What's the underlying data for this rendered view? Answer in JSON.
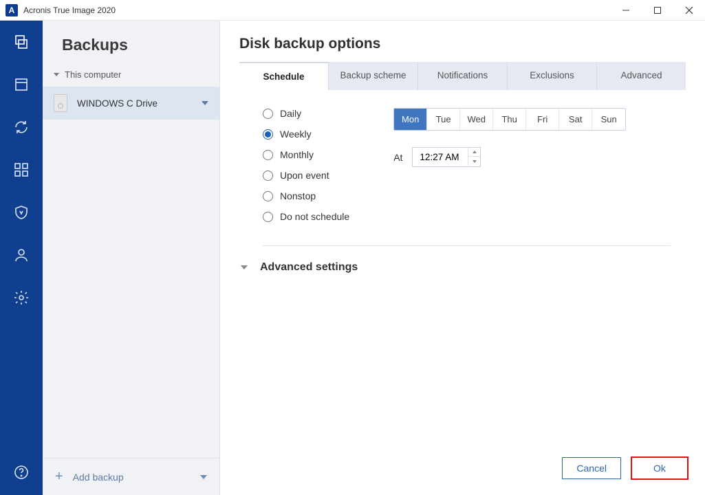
{
  "window": {
    "title": "Acronis True Image 2020",
    "logo_letter": "A"
  },
  "sidebar": {
    "heading": "Backups",
    "tree_label": "This computer",
    "plan_name": "WINDOWS C Drive",
    "add_backup_label": "Add backup"
  },
  "main": {
    "title": "Disk backup options",
    "tabs": [
      {
        "label": "Schedule",
        "active": true
      },
      {
        "label": "Backup scheme",
        "active": false
      },
      {
        "label": "Notifications",
        "active": false
      },
      {
        "label": "Exclusions",
        "active": false
      },
      {
        "label": "Advanced",
        "active": false
      }
    ],
    "schedule_options": [
      {
        "label": "Daily",
        "selected": false
      },
      {
        "label": "Weekly",
        "selected": true
      },
      {
        "label": "Monthly",
        "selected": false
      },
      {
        "label": "Upon event",
        "selected": false
      },
      {
        "label": "Nonstop",
        "selected": false
      },
      {
        "label": "Do not schedule",
        "selected": false
      }
    ],
    "days": [
      {
        "label": "Mon",
        "selected": true
      },
      {
        "label": "Tue",
        "selected": false
      },
      {
        "label": "Wed",
        "selected": false
      },
      {
        "label": "Thu",
        "selected": false
      },
      {
        "label": "Fri",
        "selected": false
      },
      {
        "label": "Sat",
        "selected": false
      },
      {
        "label": "Sun",
        "selected": false
      }
    ],
    "at_label": "At",
    "time_value": "12:27 AM",
    "advanced_label": "Advanced settings"
  },
  "footer": {
    "cancel": "Cancel",
    "ok": "Ok"
  }
}
